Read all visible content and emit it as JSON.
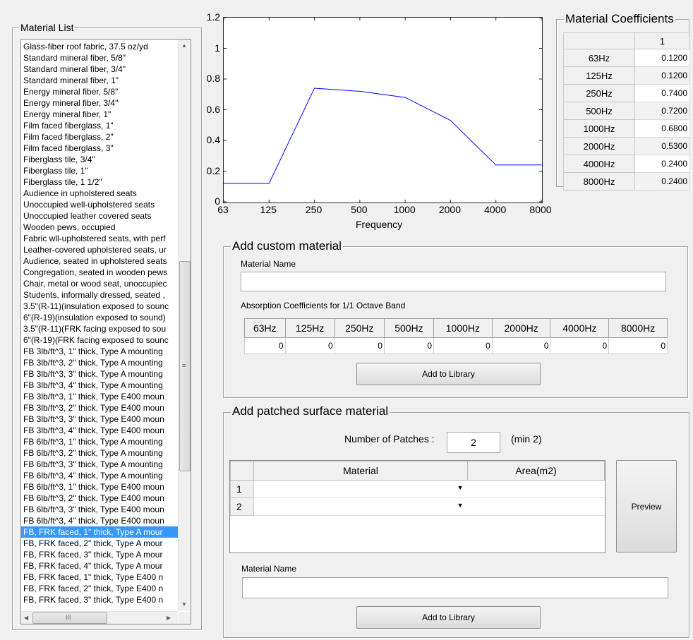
{
  "material_list": {
    "title": "Material List",
    "items": [
      "Glass-fiber roof fabric, 37.5 oz/yd",
      "Standard mineral fiber, 5/8\"",
      "Standard mineral fiber, 3/4\"",
      "Standard mineral fiber, 1\"",
      "Energy mineral fiber, 5/8\"",
      "Energy mineral fiber, 3/4\"",
      "Energy mineral fiber, 1\"",
      "Film faced fiberglass, 1\"",
      "Film faced fiberglass, 2\"",
      "Film faced fiberglass, 3\"",
      "Fiberglass tile, 3/4\"",
      "Fiberglass tile, 1\"",
      "Fiberglass tile, 1 1/2\"",
      "Audience in upholstered seats",
      "Unoccupied well-upholstered seats",
      "Unoccupied leather covered seats",
      "Wooden pews, occupied",
      "Fabric wll-upholstered seats, with perf",
      "Leather-covered upholstered seats, ur",
      "Audience, seated in upholstered seats",
      "Congregation, seated in wooden pews",
      "Chair, metal or wood seat, unoccupiec",
      "Students, informally dressed, seated ,",
      "3.5\"(R-11)(insulation exposed to sounc",
      "6\"(R-19)(insulation exposed to sound)",
      "3.5\"(R-11)(FRK facing exposed to sou",
      "6\"(R-19)(FRK facing exposed to sounc",
      "FB 3lb/ft^3, 1\" thick, Type A mounting",
      "FB 3lb/ft^3, 2\" thick, Type A mounting",
      "FB 3lb/ft^3, 3\" thick, Type A mounting",
      "FB 3lb/ft^3, 4\" thick, Type A mounting",
      "FB 3lb/ft^3, 1\" thick, Type E400 moun",
      "FB 3lb/ft^3, 2\" thick, Type E400 moun",
      "FB 3lb/ft^3, 3\" thick, Type E400 moun",
      "FB 3lb/ft^3, 4\" thick, Type E400 moun",
      "FB 6lb/ft^3, 1\" thick, Type A mounting",
      "FB 6lb/ft^3, 2\" thick, Type A mounting",
      "FB 6lb/ft^3, 3\" thick, Type A mounting",
      "FB 6lb/ft^3, 4\" thick, Type A mounting",
      "FB 6lb/ft^3, 1\" thick, Type E400 moun",
      "FB 6lb/ft^3, 2\" thick, Type E400 moun",
      "FB 6lb/ft^3, 3\" thick, Type E400 moun",
      "FB 6lb/ft^3, 4\" thick, Type E400 moun",
      "FB, FRK faced, 1\" thick, Type A mour",
      "FB, FRK faced, 2\" thick, Type A mour",
      "FB, FRK faced, 3\" thick, Type A mour",
      "FB, FRK faced, 4\" thick, Type A mour",
      "FB, FRK faced, 1\" thick, Type E400 n",
      "FB, FRK faced, 2\" thick, Type E400 n",
      "FB, FRK faced, 3\" thick, Type E400 n"
    ],
    "selected_index": 43,
    "hscroll_label": "III"
  },
  "chart_data": {
    "type": "line",
    "categories": [
      "63",
      "125",
      "250",
      "500",
      "1000",
      "2000",
      "4000",
      "8000"
    ],
    "values": [
      0.12,
      0.12,
      0.74,
      0.72,
      0.68,
      0.53,
      0.24,
      0.24
    ],
    "ylim": [
      0,
      1.2
    ],
    "yticks": [
      "0",
      "0.2",
      "0.4",
      "0.6",
      "0.8",
      "1",
      "1.2"
    ],
    "xlabel": "Frequency",
    "ylabel": "",
    "title": "",
    "line_color": "#0000ff"
  },
  "coefficients": {
    "title": "Material Coefficients",
    "column_header": "1",
    "rows": [
      {
        "label": "63Hz",
        "value": "0.1200"
      },
      {
        "label": "125Hz",
        "value": "0.1200"
      },
      {
        "label": "250Hz",
        "value": "0.7400"
      },
      {
        "label": "500Hz",
        "value": "0.7200"
      },
      {
        "label": "1000Hz",
        "value": "0.6800"
      },
      {
        "label": "2000Hz",
        "value": "0.5300"
      },
      {
        "label": "4000Hz",
        "value": "0.2400"
      },
      {
        "label": "8000Hz",
        "value": "0.2400"
      }
    ]
  },
  "custom": {
    "title": "Add custom material",
    "name_label": "Material Name",
    "name_value": "",
    "absorption_label": "Absorption Coefficients for 1/1 Octave Band",
    "bands": [
      "63Hz",
      "125Hz",
      "250Hz",
      "500Hz",
      "1000Hz",
      "2000Hz",
      "4000Hz",
      "8000Hz"
    ],
    "band_values": [
      "0",
      "0",
      "0",
      "0",
      "0",
      "0",
      "0",
      "0"
    ],
    "add_button": "Add to Library"
  },
  "patched": {
    "title": "Add patched surface material",
    "patches_label": "Number of Patches :",
    "patches_value": "2",
    "patches_hint": "(min 2)",
    "col_material": "Material",
    "col_area": "Area(m2)",
    "rows": [
      {
        "num": "1",
        "material": "",
        "area": ""
      },
      {
        "num": "2",
        "material": "",
        "area": ""
      }
    ],
    "preview_button": "Preview",
    "name_label": "Material Name",
    "name_value": "",
    "add_button": "Add to Library"
  }
}
